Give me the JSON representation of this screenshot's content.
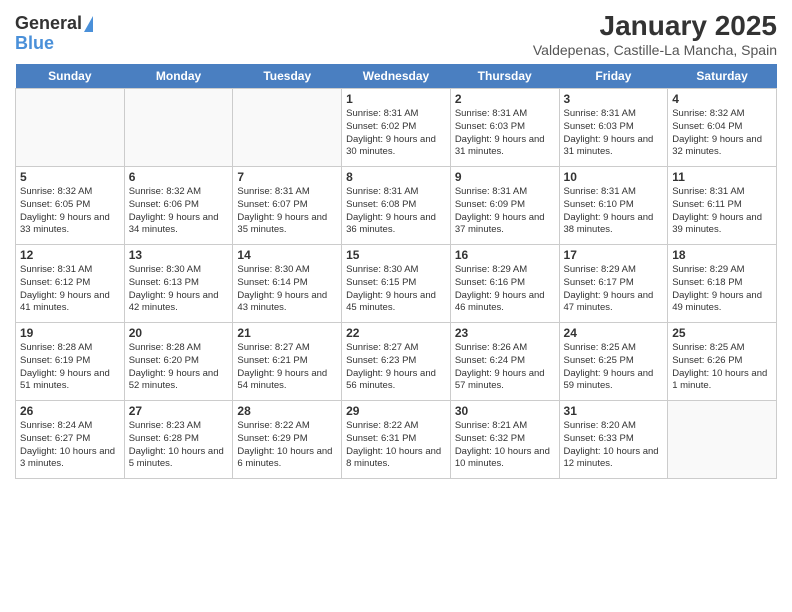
{
  "logo": {
    "line1": "General",
    "line2": "Blue"
  },
  "title": "January 2025",
  "subtitle": "Valdepenas, Castille-La Mancha, Spain",
  "headers": [
    "Sunday",
    "Monday",
    "Tuesday",
    "Wednesday",
    "Thursday",
    "Friday",
    "Saturday"
  ],
  "weeks": [
    [
      {
        "day": "",
        "content": ""
      },
      {
        "day": "",
        "content": ""
      },
      {
        "day": "",
        "content": ""
      },
      {
        "day": "1",
        "content": "Sunrise: 8:31 AM\nSunset: 6:02 PM\nDaylight: 9 hours and 30 minutes."
      },
      {
        "day": "2",
        "content": "Sunrise: 8:31 AM\nSunset: 6:03 PM\nDaylight: 9 hours and 31 minutes."
      },
      {
        "day": "3",
        "content": "Sunrise: 8:31 AM\nSunset: 6:03 PM\nDaylight: 9 hours and 31 minutes."
      },
      {
        "day": "4",
        "content": "Sunrise: 8:32 AM\nSunset: 6:04 PM\nDaylight: 9 hours and 32 minutes."
      }
    ],
    [
      {
        "day": "5",
        "content": "Sunrise: 8:32 AM\nSunset: 6:05 PM\nDaylight: 9 hours and 33 minutes."
      },
      {
        "day": "6",
        "content": "Sunrise: 8:32 AM\nSunset: 6:06 PM\nDaylight: 9 hours and 34 minutes."
      },
      {
        "day": "7",
        "content": "Sunrise: 8:31 AM\nSunset: 6:07 PM\nDaylight: 9 hours and 35 minutes."
      },
      {
        "day": "8",
        "content": "Sunrise: 8:31 AM\nSunset: 6:08 PM\nDaylight: 9 hours and 36 minutes."
      },
      {
        "day": "9",
        "content": "Sunrise: 8:31 AM\nSunset: 6:09 PM\nDaylight: 9 hours and 37 minutes."
      },
      {
        "day": "10",
        "content": "Sunrise: 8:31 AM\nSunset: 6:10 PM\nDaylight: 9 hours and 38 minutes."
      },
      {
        "day": "11",
        "content": "Sunrise: 8:31 AM\nSunset: 6:11 PM\nDaylight: 9 hours and 39 minutes."
      }
    ],
    [
      {
        "day": "12",
        "content": "Sunrise: 8:31 AM\nSunset: 6:12 PM\nDaylight: 9 hours and 41 minutes."
      },
      {
        "day": "13",
        "content": "Sunrise: 8:30 AM\nSunset: 6:13 PM\nDaylight: 9 hours and 42 minutes."
      },
      {
        "day": "14",
        "content": "Sunrise: 8:30 AM\nSunset: 6:14 PM\nDaylight: 9 hours and 43 minutes."
      },
      {
        "day": "15",
        "content": "Sunrise: 8:30 AM\nSunset: 6:15 PM\nDaylight: 9 hours and 45 minutes."
      },
      {
        "day": "16",
        "content": "Sunrise: 8:29 AM\nSunset: 6:16 PM\nDaylight: 9 hours and 46 minutes."
      },
      {
        "day": "17",
        "content": "Sunrise: 8:29 AM\nSunset: 6:17 PM\nDaylight: 9 hours and 47 minutes."
      },
      {
        "day": "18",
        "content": "Sunrise: 8:29 AM\nSunset: 6:18 PM\nDaylight: 9 hours and 49 minutes."
      }
    ],
    [
      {
        "day": "19",
        "content": "Sunrise: 8:28 AM\nSunset: 6:19 PM\nDaylight: 9 hours and 51 minutes."
      },
      {
        "day": "20",
        "content": "Sunrise: 8:28 AM\nSunset: 6:20 PM\nDaylight: 9 hours and 52 minutes."
      },
      {
        "day": "21",
        "content": "Sunrise: 8:27 AM\nSunset: 6:21 PM\nDaylight: 9 hours and 54 minutes."
      },
      {
        "day": "22",
        "content": "Sunrise: 8:27 AM\nSunset: 6:23 PM\nDaylight: 9 hours and 56 minutes."
      },
      {
        "day": "23",
        "content": "Sunrise: 8:26 AM\nSunset: 6:24 PM\nDaylight: 9 hours and 57 minutes."
      },
      {
        "day": "24",
        "content": "Sunrise: 8:25 AM\nSunset: 6:25 PM\nDaylight: 9 hours and 59 minutes."
      },
      {
        "day": "25",
        "content": "Sunrise: 8:25 AM\nSunset: 6:26 PM\nDaylight: 10 hours and 1 minute."
      }
    ],
    [
      {
        "day": "26",
        "content": "Sunrise: 8:24 AM\nSunset: 6:27 PM\nDaylight: 10 hours and 3 minutes."
      },
      {
        "day": "27",
        "content": "Sunrise: 8:23 AM\nSunset: 6:28 PM\nDaylight: 10 hours and 5 minutes."
      },
      {
        "day": "28",
        "content": "Sunrise: 8:22 AM\nSunset: 6:29 PM\nDaylight: 10 hours and 6 minutes."
      },
      {
        "day": "29",
        "content": "Sunrise: 8:22 AM\nSunset: 6:31 PM\nDaylight: 10 hours and 8 minutes."
      },
      {
        "day": "30",
        "content": "Sunrise: 8:21 AM\nSunset: 6:32 PM\nDaylight: 10 hours and 10 minutes."
      },
      {
        "day": "31",
        "content": "Sunrise: 8:20 AM\nSunset: 6:33 PM\nDaylight: 10 hours and 12 minutes."
      },
      {
        "day": "",
        "content": ""
      }
    ]
  ]
}
